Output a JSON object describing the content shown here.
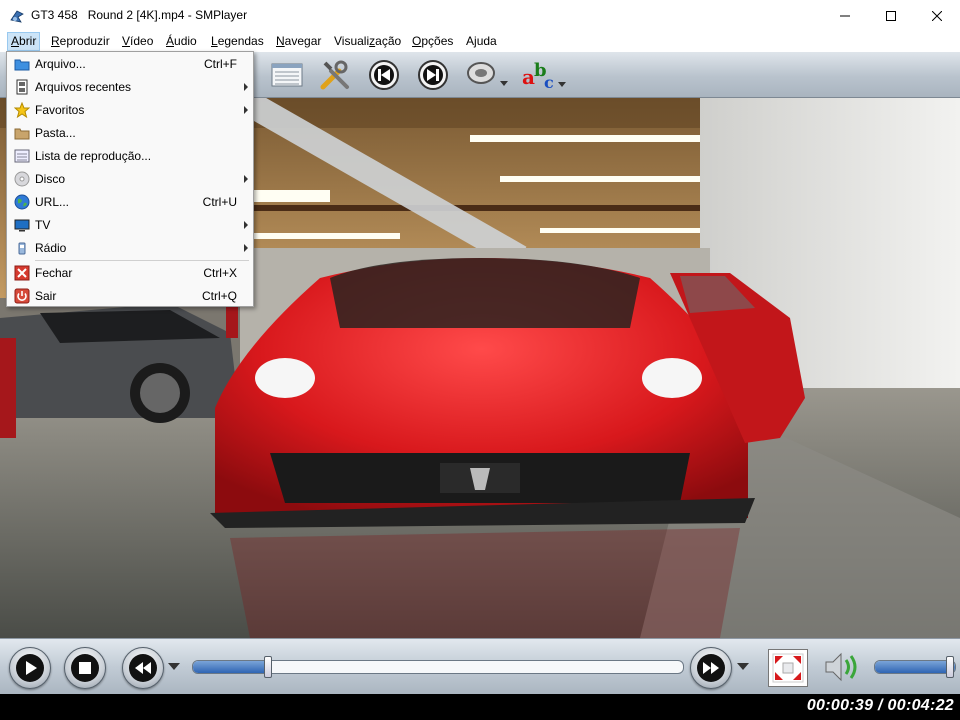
{
  "window": {
    "title": "GT3 458   Round 2 [4K].mp4 - SMPlayer",
    "minimize_icon": "minimize-icon",
    "maximize_icon": "maximize-icon",
    "close_icon": "close-icon"
  },
  "menubar": {
    "items": [
      {
        "label": "Abrir",
        "mnemonic": "A"
      },
      {
        "label": "Reproduzir",
        "mnemonic": "R"
      },
      {
        "label": "Vídeo",
        "mnemonic": "V"
      },
      {
        "label": "Áudio",
        "mnemonic": "Á"
      },
      {
        "label": "Legendas",
        "mnemonic": "L"
      },
      {
        "label": "Navegar",
        "mnemonic": "N"
      },
      {
        "label": "Visualização",
        "mnemonic": "z"
      },
      {
        "label": "Opções",
        "mnemonic": "O"
      },
      {
        "label": "Ajuda",
        "mnemonic": "j"
      }
    ],
    "active": "Abrir"
  },
  "open_menu": {
    "items": [
      {
        "label": "Arquivo...",
        "shortcut": "Ctrl+F",
        "icon": "folder-blue-icon",
        "submenu": false
      },
      {
        "label": "Arquivos recentes",
        "shortcut": "",
        "icon": "film-strip-icon",
        "submenu": true
      },
      {
        "label": "Favoritos",
        "shortcut": "",
        "icon": "star-icon",
        "submenu": true
      },
      {
        "label": "Pasta...",
        "shortcut": "",
        "icon": "folder-icon",
        "submenu": false
      },
      {
        "label": "Lista de reprodução...",
        "shortcut": "",
        "icon": "playlist-icon",
        "submenu": false
      },
      {
        "label": "Disco",
        "shortcut": "",
        "icon": "disc-icon",
        "submenu": true
      },
      {
        "label": "URL...",
        "shortcut": "Ctrl+U",
        "icon": "globe-icon",
        "submenu": false
      },
      {
        "label": "TV",
        "shortcut": "",
        "icon": "tv-icon",
        "submenu": true
      },
      {
        "label": "Rádio",
        "shortcut": "",
        "icon": "radio-icon",
        "submenu": true
      },
      {
        "label": "Fechar",
        "shortcut": "Ctrl+X",
        "icon": "close-file-icon",
        "submenu": false
      },
      {
        "label": "Sair",
        "shortcut": "Ctrl+Q",
        "icon": "power-icon",
        "submenu": false
      }
    ]
  },
  "toolbar": {
    "icons": [
      "playlist-icon",
      "preferences-tools-icon",
      "previous-track-icon",
      "next-track-icon",
      "audio-track-icon",
      "subtitles-icon"
    ]
  },
  "controls": {
    "play_icon": "play-icon",
    "stop_icon": "stop-icon",
    "rewind_icon": "rewind-icon",
    "forward_icon": "forward-icon",
    "fullscreen_icon": "fullscreen-icon",
    "volume_icon": "volume-icon",
    "seek_progress": 0.154,
    "volume_level": 1.0
  },
  "status": {
    "time": "00:00:39 / 00:04:22"
  },
  "colors": {
    "menu_highlight": "#cce4f7",
    "car_red": "#d8181c",
    "seek_fill": "#2f65b3"
  }
}
